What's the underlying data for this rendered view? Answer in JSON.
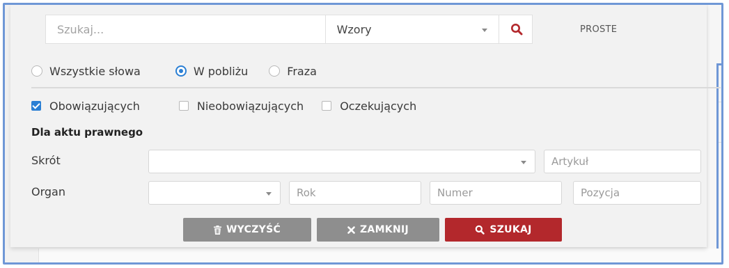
{
  "search": {
    "placeholder": "Szukaj...",
    "type_value": "Wzory",
    "simple_label": "PROSTE"
  },
  "match_mode": {
    "options": [
      {
        "label": "Wszystkie słowa",
        "selected": false
      },
      {
        "label": "W pobliżu",
        "selected": true
      },
      {
        "label": "Fraza",
        "selected": false
      }
    ]
  },
  "status_filter": {
    "options": [
      {
        "label": "Obowiązujących",
        "checked": true
      },
      {
        "label": "Nieobowiązujących",
        "checked": false
      },
      {
        "label": "Oczekujących",
        "checked": false
      }
    ]
  },
  "legal_act": {
    "title": "Dla aktu prawnego",
    "abbreviation_label": "Skrót",
    "article_placeholder": "Artykuł",
    "organ_label": "Organ",
    "year_placeholder": "Rok",
    "number_placeholder": "Numer",
    "position_placeholder": "Pozycja"
  },
  "actions": {
    "clear_label": "WYCZYŚĆ",
    "close_label": "ZAMKNIJ",
    "search_label": "SZUKAJ"
  },
  "colors": {
    "accent_blue": "#2a7fd4",
    "search_red": "#b3282c",
    "button_grey": "#8e8e8e",
    "frame_blue": "#6f97d6"
  },
  "icons": {
    "search": "magnifier-icon",
    "clear": "trash-icon",
    "close": "x-icon"
  }
}
